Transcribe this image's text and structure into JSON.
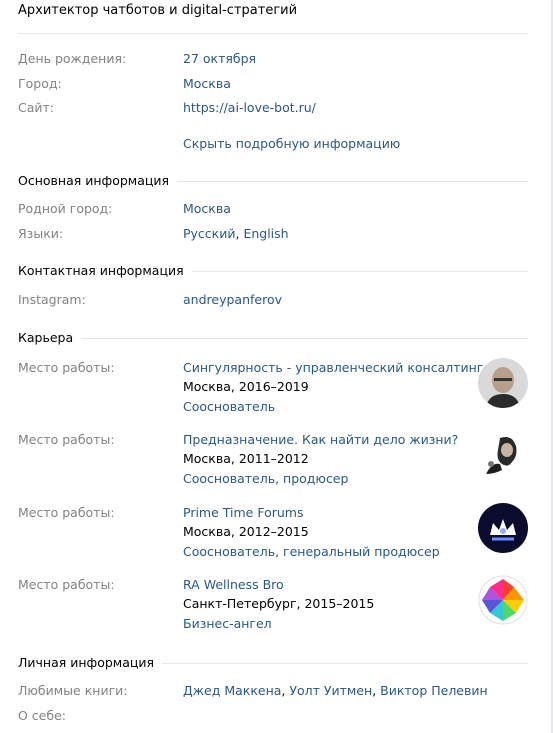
{
  "profile": {
    "tagline": "Архитектор чатботов и digital-стратегий",
    "birthday": {
      "label": "День рождения:",
      "value": "27 октября"
    },
    "city": {
      "label": "Город:",
      "value": "Москва"
    },
    "site": {
      "label": "Сайт:",
      "value": "https://ai-love-bot.ru/"
    },
    "hide_details": "Скрыть подробную информацию"
  },
  "basic": {
    "title": "Основная информация",
    "hometown": {
      "label": "Родной город:",
      "value": "Москва"
    },
    "languages": {
      "label": "Языки:",
      "values": [
        "Русский",
        "English"
      ]
    }
  },
  "contact": {
    "title": "Контактная информация",
    "instagram": {
      "label": "Instagram:",
      "value": "andreypanferov"
    }
  },
  "career": {
    "title": "Карьера",
    "jobs": [
      {
        "label": "Место работы:",
        "company": "Сингулярность - управленческий консалтинг",
        "place": "Москва, 2016–2019",
        "role": "Сооснователь"
      },
      {
        "label": "Место работы:",
        "company": "Предназначение. Как найти дело жизни?",
        "place": "Москва, 2011–2012",
        "role": "Сооснователь, продюсер"
      },
      {
        "label": "Место работы:",
        "company": "Prime Time Forums",
        "place": "Москва, 2012–2015",
        "role": "Сооснователь, генеральный продюсер"
      },
      {
        "label": "Место работы:",
        "company": "RA Wellness Bro",
        "place": "Санкт-Петербург, 2015–2015",
        "role": "Бизнес-ангел"
      }
    ]
  },
  "personal": {
    "title": "Личная информация",
    "books": {
      "label": "Любимые книги:",
      "values": [
        "Джед Маккена",
        "Уолт Уитмен",
        "Виктор Пелевин"
      ]
    },
    "about": {
      "label": "О себе:"
    }
  },
  "colors": {
    "link": "#2a5885",
    "label": "#828282",
    "divider": "#e7e8ec"
  }
}
